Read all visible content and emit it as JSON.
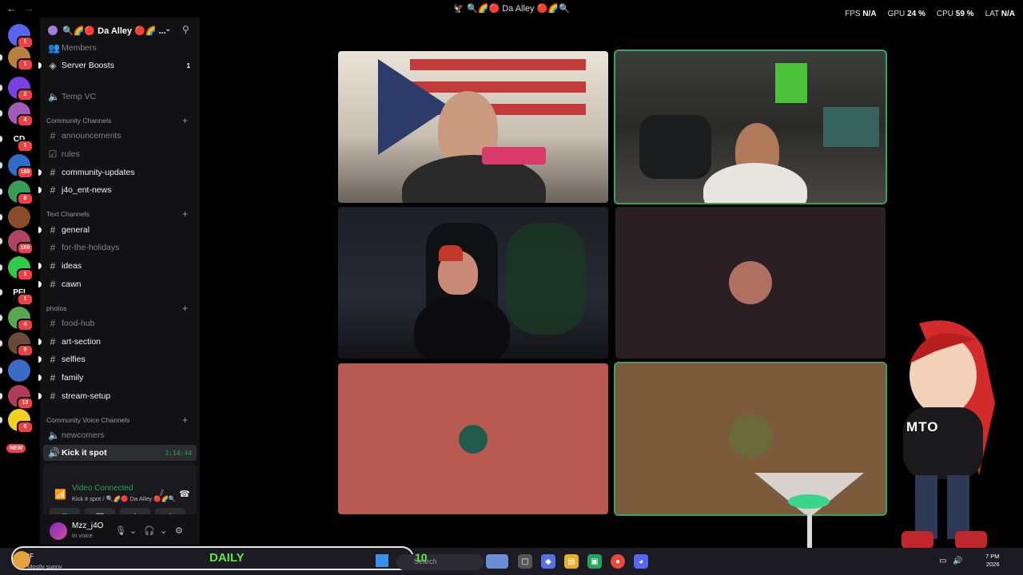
{
  "window": {
    "title": "🦅 🔍🌈🔴 Da Alley 🔴🌈🔍",
    "back_icon": "←",
    "forward_icon": "→"
  },
  "stats": {
    "fps_label": "FPS",
    "fps_value": "N/A",
    "gpu_label": "GPU",
    "gpu_value": "24 %",
    "cpu_label": "CPU",
    "cpu_value": "59 %",
    "lat_label": "LAT",
    "lat_value": "N/A"
  },
  "servers": [
    {
      "label": "",
      "badge": "1",
      "color": "#5865f2"
    },
    {
      "label": "",
      "badge": "1",
      "color": "#b7803f"
    },
    {
      "label": "",
      "badge": "2",
      "color": "#7b3fe4"
    },
    {
      "label": "",
      "badge": "4",
      "color": "#a05cb8"
    },
    {
      "label": "CD",
      "badge": "1",
      "color": "#000000"
    },
    {
      "label": "",
      "badge": "189",
      "color": "#2f6cc7"
    },
    {
      "label": "",
      "badge": "8",
      "color": "#3a9a5a"
    },
    {
      "label": "",
      "badge": "",
      "color": "#8a4b2a"
    },
    {
      "label": "",
      "badge": "169",
      "color": "#b04466"
    },
    {
      "label": "",
      "badge": "1",
      "color": "#33c94b"
    },
    {
      "label": "PFI",
      "badge": "1",
      "color": "#000000"
    },
    {
      "label": "",
      "badge": "4",
      "color": "#58a84f"
    },
    {
      "label": "",
      "badge": "9",
      "color": "#6a4a3a"
    },
    {
      "label": "",
      "badge": "",
      "color": "#3a6bc4"
    },
    {
      "label": "",
      "badge": "13",
      "color": "#b23a5a"
    },
    {
      "label": "",
      "badge": "6",
      "color": "#f0d020"
    }
  ],
  "new_label": "NEW",
  "guild": {
    "name": "🔍🌈🔴 Da Alley 🔴🌈 ..."
  },
  "channels": {
    "members": "Members",
    "server_boosts": "Server Boosts",
    "server_boosts_count": "1",
    "temp_vc": "Temp VC",
    "community_channels_cat": "Community Channels",
    "announcements": "announcements",
    "rules": "rules",
    "community_updates": "community-updates",
    "j4o_ent_news": "j4o_ent-news",
    "text_channels_cat": "Text Channels",
    "general": "general",
    "for_the_holidays": "for-the-holidays",
    "ideas": "ideas",
    "cawn": "cawn",
    "photos_cat": "photos",
    "food_hub": "food-hub",
    "art_section": "art-section",
    "selfies": "selfies",
    "family": "family",
    "stream_setup": "stream-setup",
    "community_voice_cat": "Community Voice Channels",
    "newcomers": "newcomers",
    "kick_it_spot": "Kick it spot",
    "kick_it_timer": "3:14:44"
  },
  "voice": {
    "status": "Video Connected",
    "location": "Kick it spot / 🔍🌈🔴 Da Alley 🔴🌈🔍"
  },
  "user": {
    "name": "Mzz_j4O",
    "status": "In voice"
  },
  "overlay": {
    "mto": "MTO",
    "daily": "DAILY",
    "count": "10"
  },
  "taskbar": {
    "temp": "°F",
    "weather": "Mostly sunny",
    "search_placeholder": "Search",
    "time": "7 PM",
    "date": "2026"
  }
}
